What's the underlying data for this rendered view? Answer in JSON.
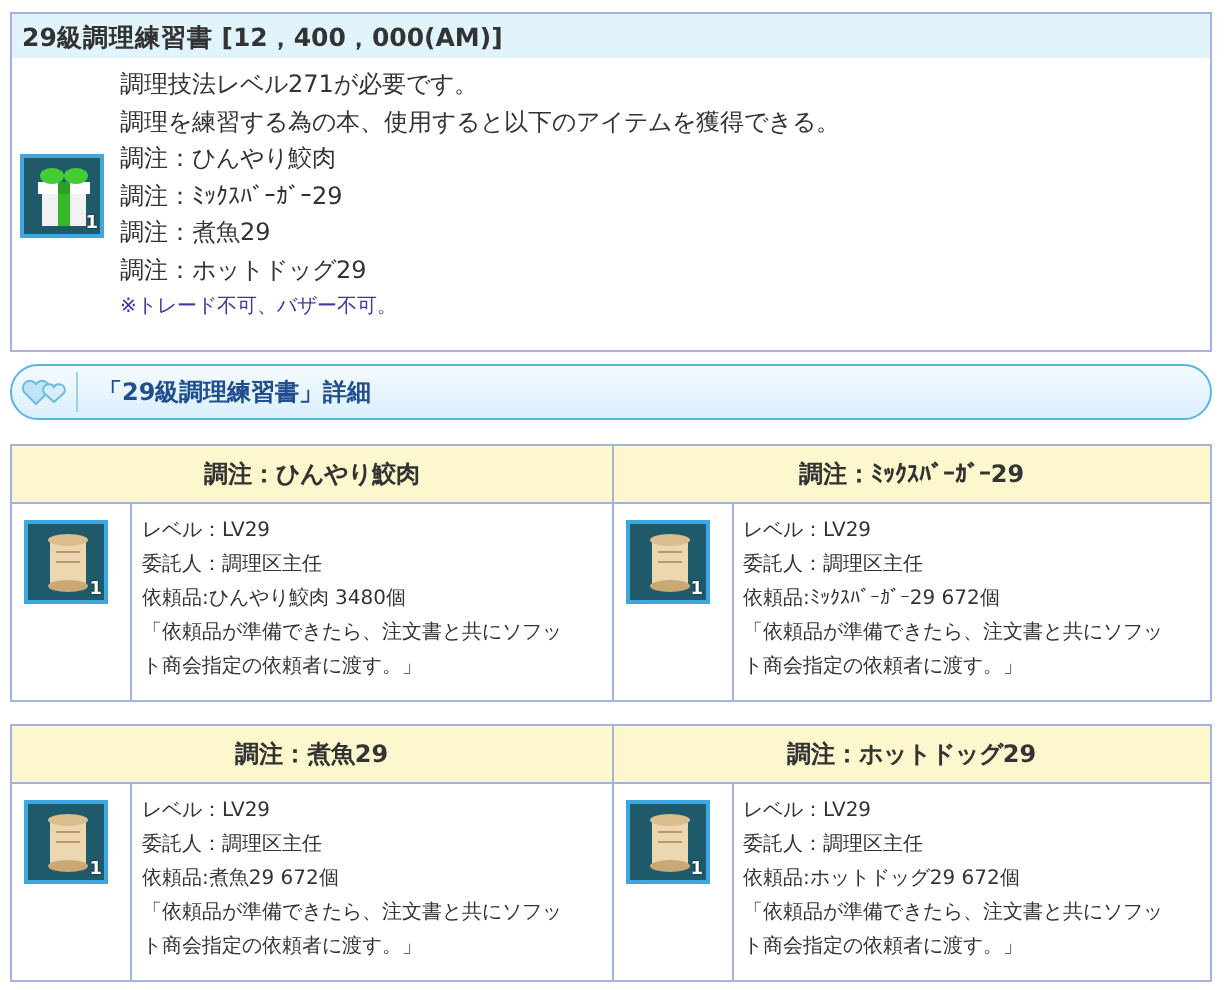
{
  "item": {
    "title": "29級調理練習書 [12，400，000(AM)]",
    "icon_count": "1",
    "lines": [
      "調理技法レベル271が必要です。",
      "調理を練習する為の本、使用すると以下のアイテムを獲得できる。",
      "調注：ひんやり鮫肉",
      "調注：ﾐｯｸｽﾊﾞｰｶﾞｰ29",
      "調注：煮魚29",
      "調注：ホットドッグ29"
    ],
    "note": "※トレード不可、バザー不可。"
  },
  "section": {
    "title": "「29級調理練習書」詳細"
  },
  "tables": [
    {
      "cards": [
        {
          "title": "調注：ひんやり鮫肉",
          "icon_count": "1",
          "lines": [
            "レベル：LV29",
            "委託人：調理区主任",
            "依頼品:ひんやり鮫肉 3480個",
            "「依頼品が準備できたら、注文書と共にソフット商会指定の依頼者に渡す。」"
          ]
        },
        {
          "title": "調注：ﾐｯｸｽﾊﾞｰｶﾞｰ29",
          "icon_count": "1",
          "lines": [
            "レベル：LV29",
            "委託人：調理区主任",
            "依頼品:ﾐｯｸｽﾊﾞｰｶﾞｰ29 672個",
            "「依頼品が準備できたら、注文書と共にソフット商会指定の依頼者に渡す。」"
          ]
        }
      ]
    },
    {
      "cards": [
        {
          "title": "調注：煮魚29",
          "icon_count": "1",
          "lines": [
            "レベル：LV29",
            "委託人：調理区主任",
            "依頼品:煮魚29 672個",
            "「依頼品が準備できたら、注文書と共にソフット商会指定の依頼者に渡す。」"
          ]
        },
        {
          "title": "調注：ホットドッグ29",
          "icon_count": "1",
          "lines": [
            "レベル：LV29",
            "委託人：調理区主任",
            "依頼品:ホットドッグ29 672個",
            "「依頼品が準備できたら、注文書と共にソフット商会指定の依頼者に渡す。」"
          ]
        }
      ]
    }
  ]
}
